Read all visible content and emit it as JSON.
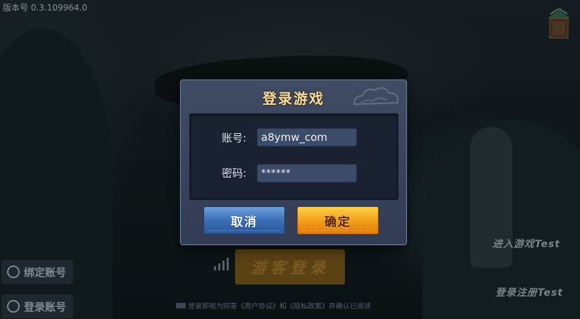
{
  "version_text": "版本号 0.3.109964.0",
  "background": {
    "bind_account_label": "绑定账号",
    "login_account_label": "登录账号",
    "guest_login_label": "游客登录",
    "enter_game_test": "进入游戏Test",
    "register_test": "登录注册Test",
    "agreement_text": "登录即视为同意《用户协议》和《隐私政策》并确认已阅读"
  },
  "dialog": {
    "title": "登录游戏",
    "account_label": "账号:",
    "account_value": "a8ymw_com",
    "password_label": "密码:",
    "password_value": "******",
    "cancel_label": "取消",
    "confirm_label": "确定"
  },
  "colors": {
    "title_gold": "#f4dca4",
    "cancel_blue": "#3a6eb6",
    "confirm_orange": "#f3a01a"
  },
  "icons": {
    "user": "user-icon",
    "login": "login-icon",
    "pavilion": "pavilion-icon"
  }
}
